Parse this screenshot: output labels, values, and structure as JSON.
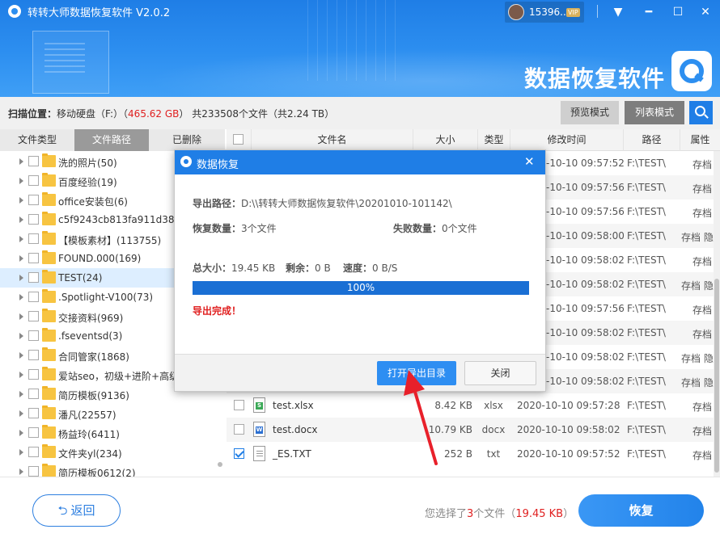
{
  "app": {
    "title": "转转大师数据恢复软件 V2.0.2",
    "user_id": "15396...",
    "vip": "VIP",
    "brand": "数据恢复软件",
    "controls": {
      "menu": "▼",
      "minimize": "━",
      "maximize": "☐",
      "close": "✕"
    }
  },
  "scan": {
    "location_label": "扫描位置：",
    "location": "移动硬盘（F:）",
    "size_open": "（",
    "size": "465.62 GB",
    "size_close": "）",
    "total": "共233508个文件（共2.24 TB）",
    "preview_mode": "预览模式",
    "list_mode": "列表模式"
  },
  "left": {
    "tabs": [
      "文件类型",
      "文件路径",
      "已删除"
    ],
    "active_tab": 1,
    "items": [
      "洗的照片(50)",
      "百度经验(19)",
      "office安装包(6)",
      "c5f9243cb813fa911d38b",
      "【模板素材】(113755)",
      "FOUND.000(169)",
      "TEST(24)",
      ".Spotlight-V100(73)",
      "交接资料(969)",
      ".fseventsd(3)",
      "合同管家(1868)",
      "爱站seo，初级+进阶+高级",
      "简历模板(9136)",
      "潘凡(22557)",
      "杨益玲(6411)",
      "文件夹yl(234)",
      "简历模板0612(2)"
    ]
  },
  "table": {
    "headers": [
      "文件名",
      "大小",
      "类型",
      "修改时间",
      "路径",
      "属性"
    ],
    "hidden_rows": [
      {
        "time": "-10-10 09:57:52",
        "path": "F:\\TEST\\",
        "attr": "存档"
      },
      {
        "time": "-10-10 09:57:56",
        "path": "F:\\TEST\\",
        "attr": "存档"
      },
      {
        "time": "-10-10 09:57:56",
        "path": "F:\\TEST\\",
        "attr": "存档"
      },
      {
        "time": "-10-10 09:58:00",
        "path": "F:\\TEST\\",
        "attr": "存档 隐"
      },
      {
        "time": "-10-10 09:58:02",
        "path": "F:\\TEST\\",
        "attr": "存档"
      },
      {
        "time": "-10-10 09:58:02",
        "path": "F:\\TEST\\",
        "attr": "存档 隐"
      },
      {
        "time": "-10-10 09:57:56",
        "path": "F:\\TEST\\",
        "attr": "存档"
      },
      {
        "time": "-10-10 09:58:02",
        "path": "F:\\TEST\\",
        "attr": "存档"
      },
      {
        "time": "-10-10 09:58:02",
        "path": "F:\\TEST\\",
        "attr": "存档 隐"
      },
      {
        "time": "-10-10 09:58:02",
        "path": "F:\\TEST\\",
        "attr": "存档 隐"
      }
    ],
    "rows": [
      {
        "name": "test.xlsx",
        "size": "8.42 KB",
        "type": "xlsx",
        "time": "2020-10-10 09:57:28",
        "path": "F:\\TEST\\",
        "attr": "存档",
        "checked": false,
        "icon": "xlsx-file-icon"
      },
      {
        "name": "test.docx",
        "size": "10.79 KB",
        "type": "docx",
        "time": "2020-10-10 09:58:02",
        "path": "F:\\TEST\\",
        "attr": "存档",
        "checked": false,
        "icon": "docx-file-icon"
      },
      {
        "name": "_ES.TXT",
        "size": "252 B",
        "type": "txt",
        "time": "2020-10-10 09:57:52",
        "path": "F:\\TEST\\",
        "attr": "存档",
        "checked": true,
        "icon": "txt-file-icon"
      }
    ]
  },
  "footer": {
    "back": "返回",
    "selected_prefix": "您选择了",
    "selected_count": "3",
    "selected_mid": "个文件（",
    "selected_size": "19.45 KB",
    "selected_suffix": "）",
    "restore": "恢复"
  },
  "dialog": {
    "title": "数据恢复",
    "close": "✕",
    "path_label": "导出路径：",
    "path": "D:\\\\转转大师数据恢复软件\\20201010-101142\\",
    "recover_label": "恢复数量：",
    "recover": "3个文件",
    "fail_label": "失败数量：",
    "fail": "0个文件",
    "total_label": "总大小：",
    "total": "19.45 KB",
    "remain_label": "剩余：",
    "remain": "0 B",
    "speed_label": "速度：",
    "speed": "0 B/S",
    "progress": 100,
    "progress_text": "100%",
    "done": "导出完成！",
    "open_dir": "打开导出目录",
    "close_btn": "关闭"
  },
  "colors": {
    "primary": "#1f7ee6",
    "accent_red": "#e02020",
    "progress": "#1a6fd4",
    "annotation_arrow": "#e8202a"
  }
}
